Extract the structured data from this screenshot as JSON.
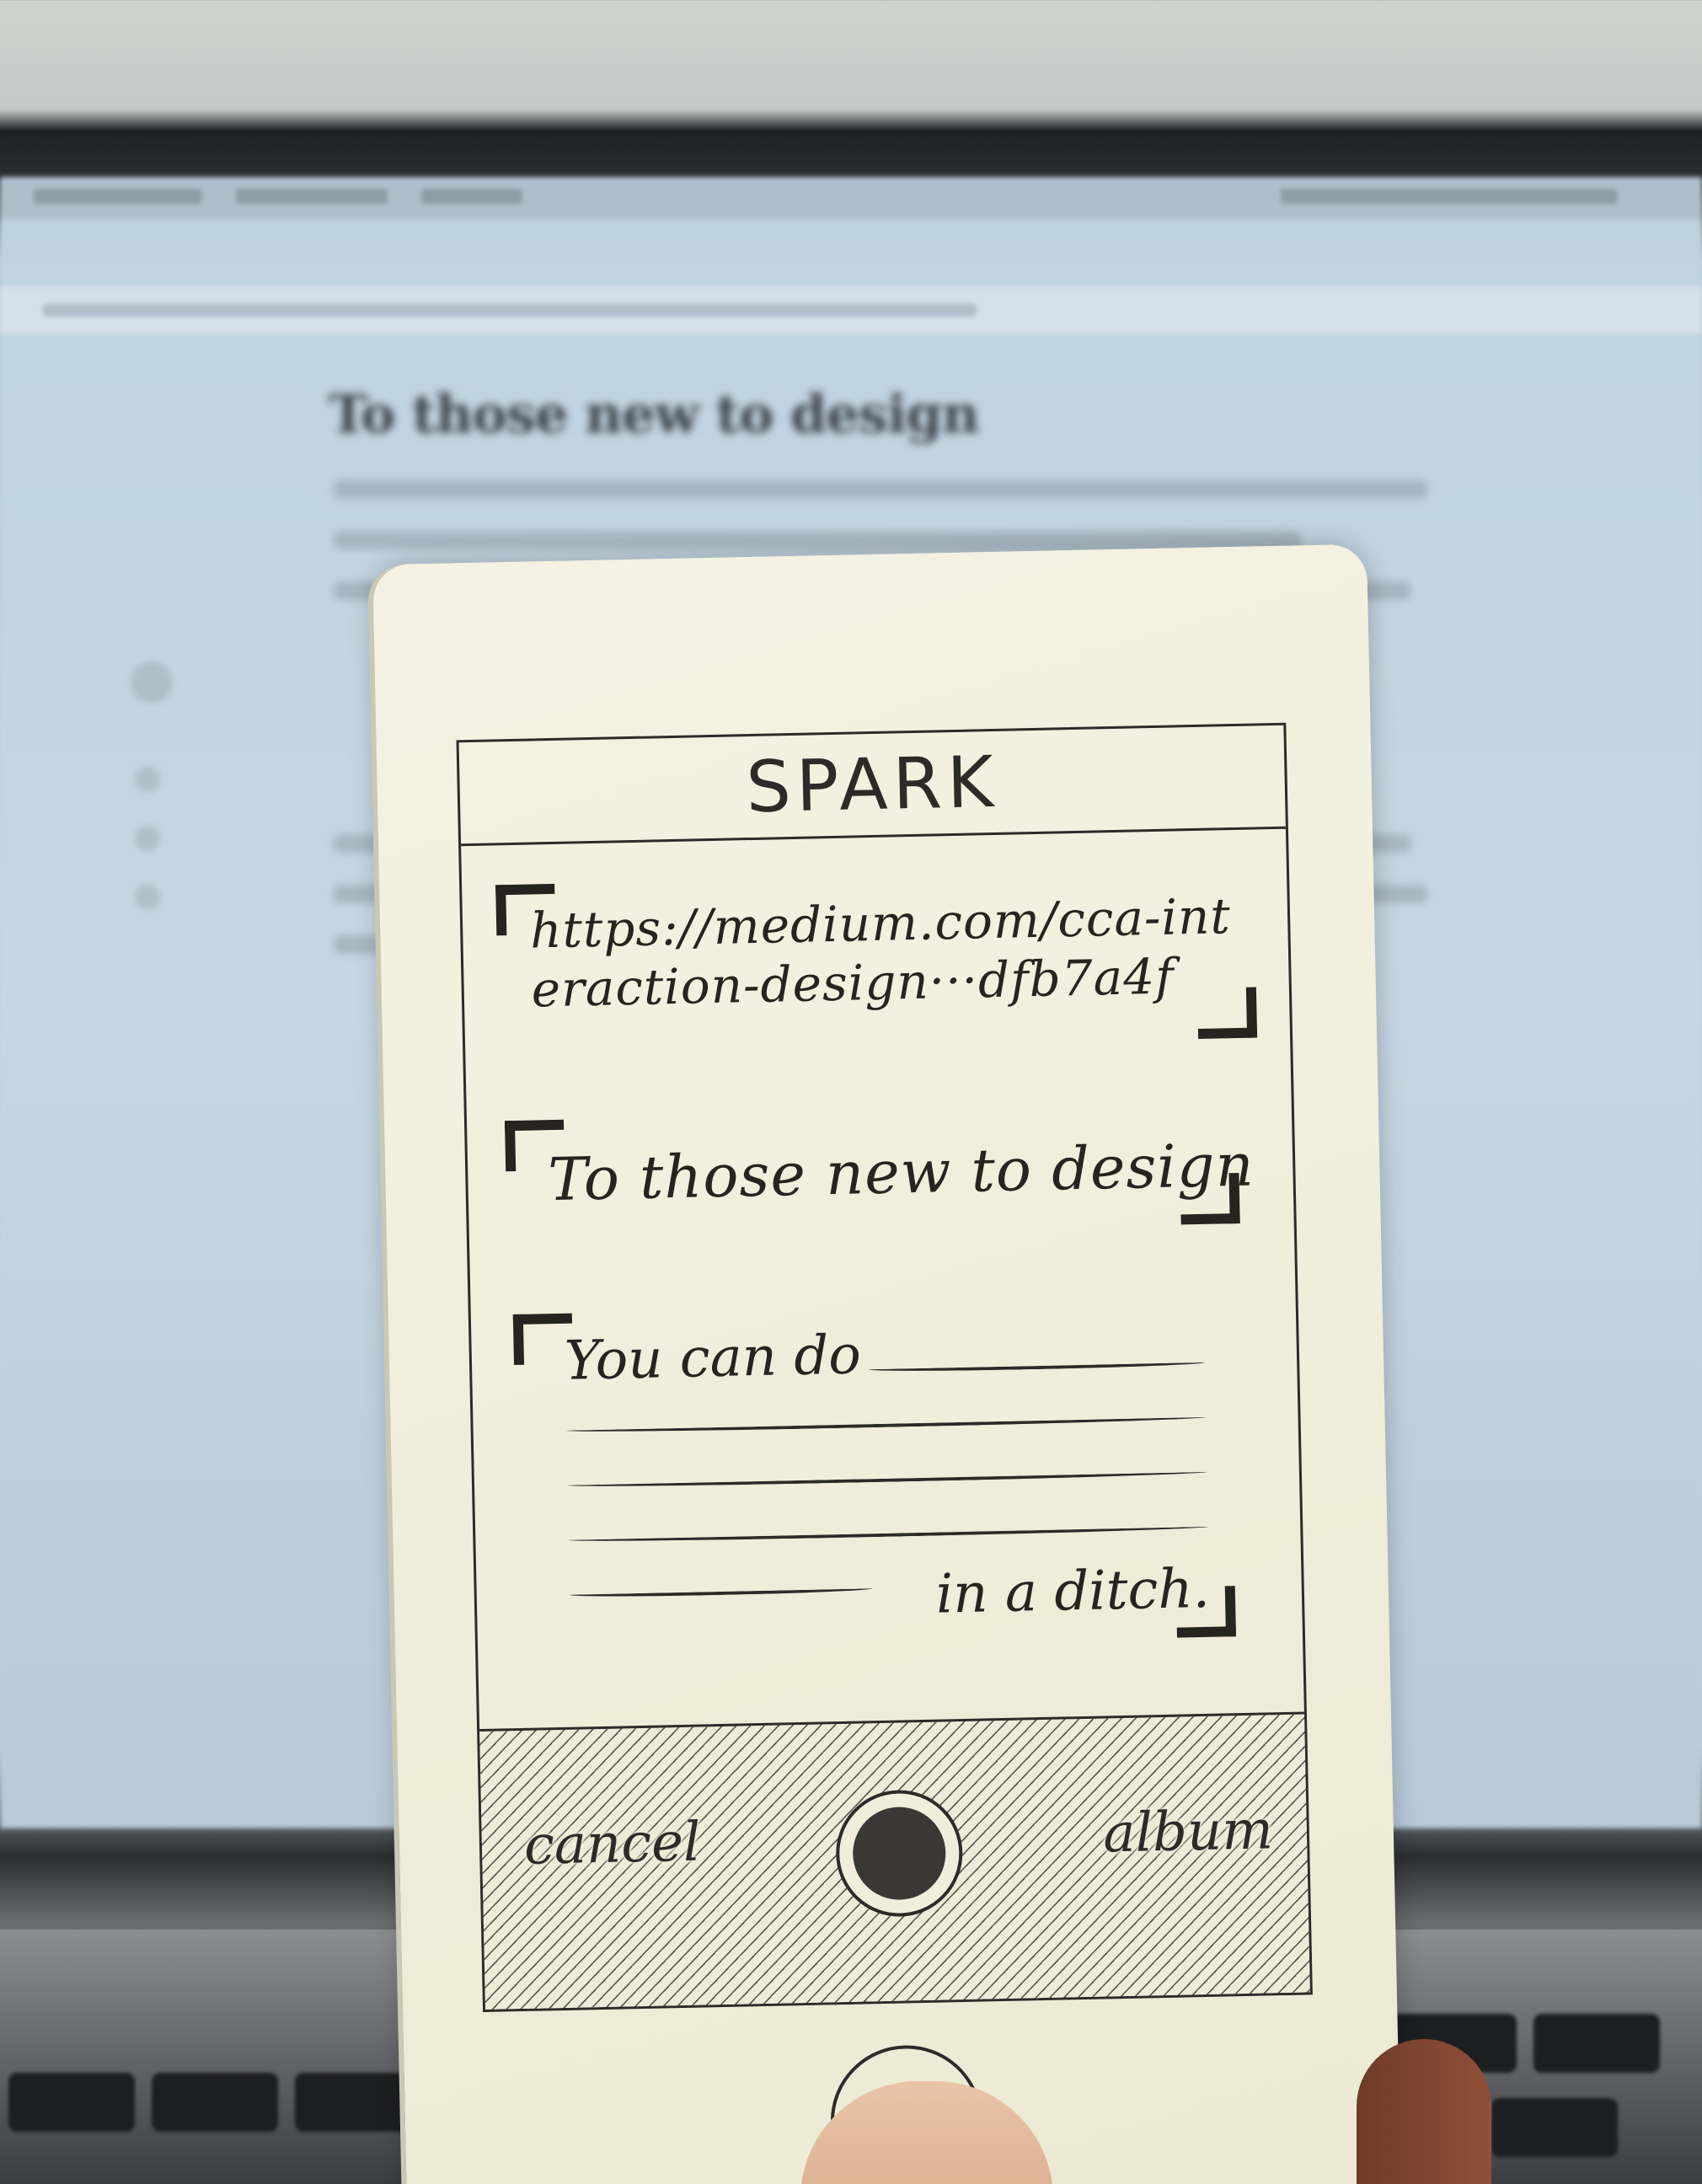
{
  "background_screen": {
    "article_title": "To those new to design"
  },
  "app": {
    "title": "SPARK",
    "url_field": {
      "value": "https://medium.com/cca-interaction-design···dfb7a4f"
    },
    "title_field": {
      "value": "To those new to design"
    },
    "body_field": {
      "start_text": "You can do",
      "end_text": "in a ditch."
    },
    "action_bar": {
      "cancel_label": "cancel",
      "album_label": "album"
    }
  },
  "icons": [
    "shutter-icon",
    "home-button-icon"
  ],
  "colors": {
    "paper": "#f2f0de",
    "ink": "#2c2b28",
    "screen_blue": "#c3d3df"
  }
}
